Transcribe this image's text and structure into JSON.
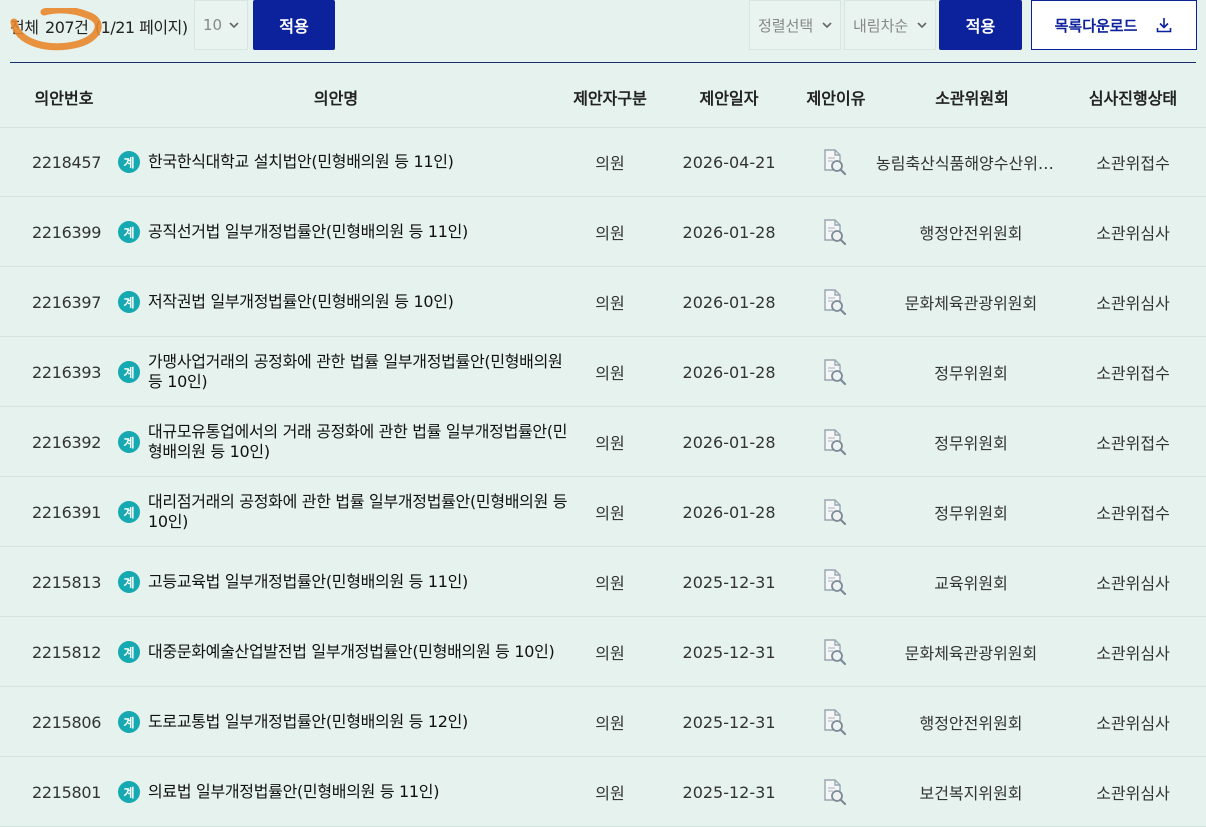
{
  "toolbar": {
    "total_prefix": "전체",
    "total_count": "207건",
    "page_info": "(1/21 페이지)",
    "page_size_value": "10",
    "apply_label": "적용",
    "sort_select_value": "정렬선택",
    "order_select_value": "내림차순",
    "apply2_label": "적용",
    "download_label": "목록다운로드",
    "primary_color": "#0c219c"
  },
  "table": {
    "headers": {
      "no": "의안번호",
      "title": "의안명",
      "proposer_type": "제안자구분",
      "date": "제안일자",
      "reason": "제안이유",
      "committee": "소관위원회",
      "status": "심사진행상태"
    },
    "badge_label": "계",
    "rows": [
      {
        "no": "2218457",
        "title": "한국한식대학교 설치법안(민형배의원 등 11인)",
        "kind": "의원",
        "date": "2026-04-21",
        "committee": "농림축산식품해양수산위원회",
        "status": "소관위접수"
      },
      {
        "no": "2216399",
        "title": "공직선거법 일부개정법률안(민형배의원 등 11인)",
        "kind": "의원",
        "date": "2026-01-28",
        "committee": "행정안전위원회",
        "status": "소관위심사"
      },
      {
        "no": "2216397",
        "title": "저작권법 일부개정법률안(민형배의원 등 10인)",
        "kind": "의원",
        "date": "2026-01-28",
        "committee": "문화체육관광위원회",
        "status": "소관위심사"
      },
      {
        "no": "2216393",
        "title": "가맹사업거래의 공정화에 관한 법률 일부개정법률안(민형배의원 등 10인)",
        "kind": "의원",
        "date": "2026-01-28",
        "committee": "정무위원회",
        "status": "소관위접수"
      },
      {
        "no": "2216392",
        "title": "대규모유통업에서의 거래 공정화에 관한 법률 일부개정법률안(민형배의원 등 10인)",
        "kind": "의원",
        "date": "2026-01-28",
        "committee": "정무위원회",
        "status": "소관위접수"
      },
      {
        "no": "2216391",
        "title": "대리점거래의 공정화에 관한 법률 일부개정법률안(민형배의원 등 10인)",
        "kind": "의원",
        "date": "2026-01-28",
        "committee": "정무위원회",
        "status": "소관위접수"
      },
      {
        "no": "2215813",
        "title": "고등교육법 일부개정법률안(민형배의원 등 11인)",
        "kind": "의원",
        "date": "2025-12-31",
        "committee": "교육위원회",
        "status": "소관위심사"
      },
      {
        "no": "2215812",
        "title": "대중문화예술산업발전법 일부개정법률안(민형배의원 등 10인)",
        "kind": "의원",
        "date": "2025-12-31",
        "committee": "문화체육관광위원회",
        "status": "소관위심사"
      },
      {
        "no": "2215806",
        "title": "도로교통법 일부개정법률안(민형배의원 등 12인)",
        "kind": "의원",
        "date": "2025-12-31",
        "committee": "행정안전위원회",
        "status": "소관위심사"
      },
      {
        "no": "2215801",
        "title": "의료법 일부개정법률안(민형배의원 등 11인)",
        "kind": "의원",
        "date": "2025-12-31",
        "committee": "보건복지위원회",
        "status": "소관위심사"
      }
    ]
  }
}
